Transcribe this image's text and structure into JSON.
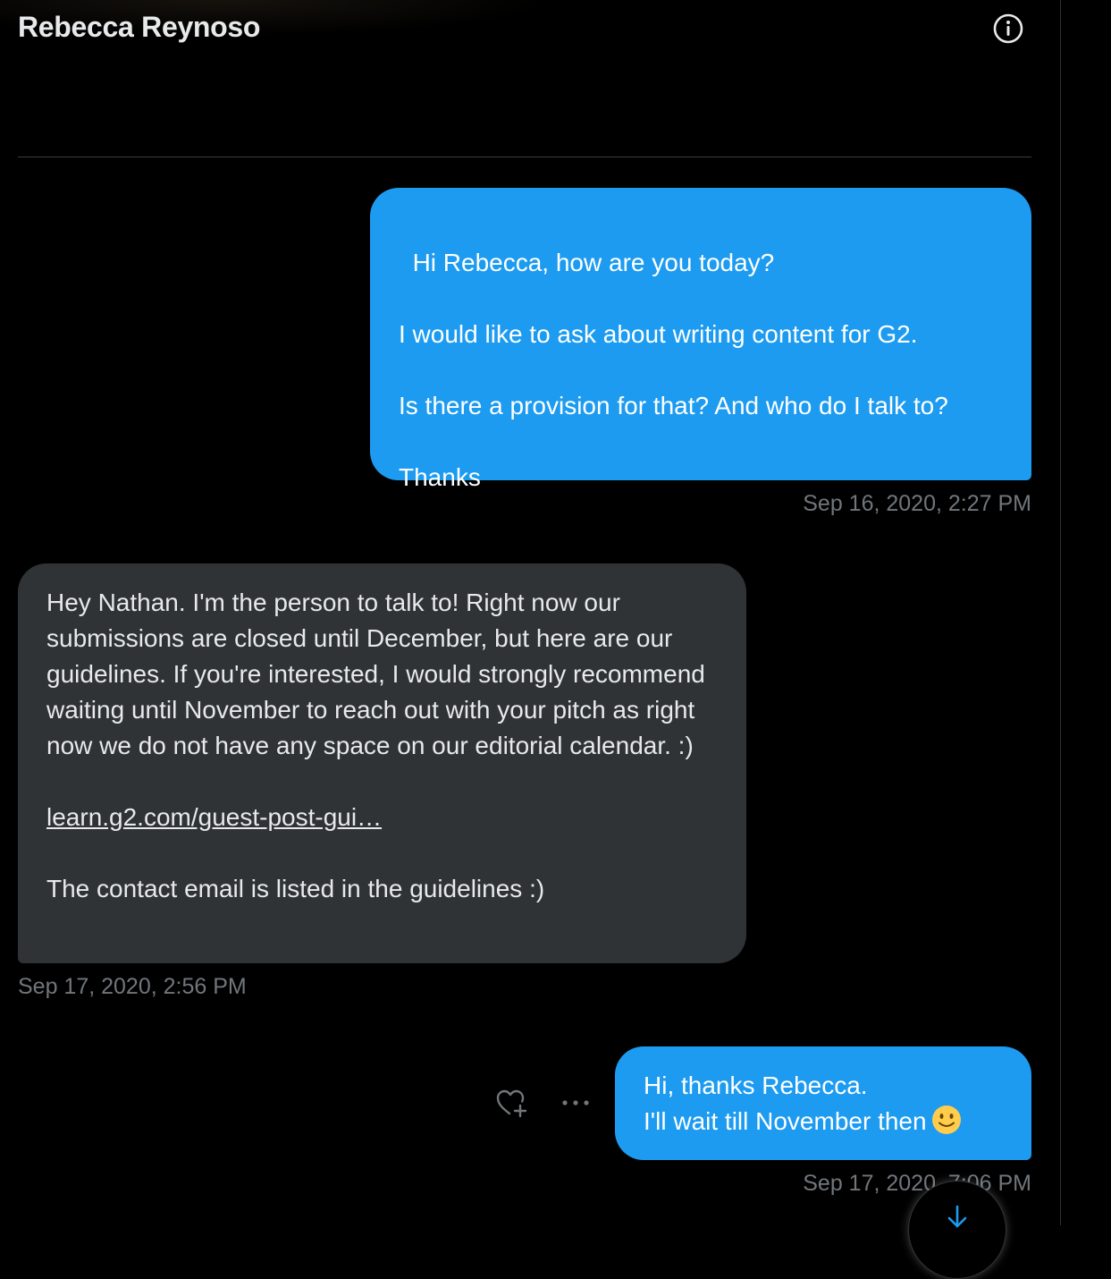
{
  "header": {
    "title": "Rebecca Reynoso",
    "info_icon": "info-circle-icon"
  },
  "messages": [
    {
      "direction": "outgoing",
      "text": "Hi Rebecca, how are you today?\n\nI would like to ask about writing content for G2.\n\nIs there a provision for that? And who do I talk to?\n\nThanks",
      "timestamp": "Sep 16, 2020, 2:27 PM"
    },
    {
      "direction": "incoming",
      "text_before_link": "Hey Nathan. I'm the person to talk to! Right now our submissions are closed until December, but here are our guidelines. If you're interested, I would strongly recommend waiting until November to reach out with your pitch as right now we do not have any space on our editorial calendar. :)",
      "link": "learn.g2.com/guest-post-gui…",
      "text_after_link": "The contact email is listed in the guidelines :)",
      "timestamp": "Sep 17, 2020, 2:56 PM"
    },
    {
      "direction": "outgoing",
      "line1": "Hi, thanks Rebecca.",
      "line2": "I'll wait till November then",
      "emoji": "slightly-smiling-face",
      "timestamp": "Sep 17, 2020, 7:06 PM"
    }
  ],
  "actions": {
    "react_icon": "heart-plus-icon",
    "more_icon": "ellipsis-icon",
    "scroll_icon": "arrow-down-icon"
  },
  "colors": {
    "background": "#000000",
    "outgoing_bubble": "#1d9bf0",
    "incoming_bubble": "#2f3336",
    "timestamp": "#71767b",
    "text": "#e7e9ea"
  }
}
